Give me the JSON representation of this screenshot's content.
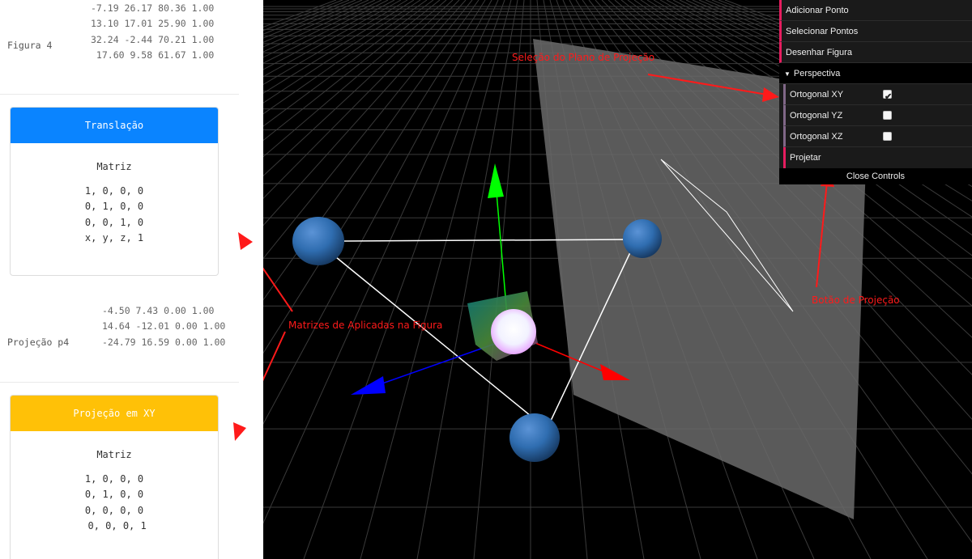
{
  "figure4": {
    "label": "Figura 4",
    "rows": [
      "-7.19 26.17 80.36 1.00",
      "13.10 17.01 25.90 1.00",
      "32.24 -2.44 70.21 1.00",
      " 17.60 9.58 61.67 1.00"
    ]
  },
  "translation_card": {
    "header": "Translação",
    "header_color": "#0a84ff",
    "title": "Matriz",
    "rows": [
      "1, 0, 0, 0",
      "0, 1, 0, 0",
      "0, 0, 1, 0",
      "x, y, z, 1"
    ]
  },
  "projection_p4": {
    "label": "Projeção p4",
    "rows": [
      "-4.50 7.43 0.00 1.00",
      "14.64 -12.01 0.00 1.00",
      "-24.79 16.59 0.00 1.00"
    ]
  },
  "projection_card": {
    "header": "Projeção em XY",
    "header_color": "#ffc107",
    "title": "Matriz",
    "rows": [
      "1, 0, 0, 0",
      "0, 1, 0, 0",
      "0, 0, 0, 0",
      " 0, 0, 0, 1"
    ]
  },
  "controls": {
    "add_point": "Adicionar Ponto",
    "select_points": "Selecionar Pontos",
    "draw_figure": "Desenhar Figura",
    "perspective_folder": "Perspectiva",
    "ortho_xy": {
      "label": "Ortogonal XY",
      "checked": true
    },
    "ortho_yz": {
      "label": "Ortogonal YZ",
      "checked": false
    },
    "ortho_xz": {
      "label": "Ortogonal XZ",
      "checked": false
    },
    "project": "Projetar",
    "close": "Close Controls"
  },
  "annotations": {
    "plane_selection": "Seleção do Plano de Projeção",
    "applied_matrices": "Matrizes de Aplicadas na Figura",
    "projection_button": "Botão de Projeção"
  },
  "colors": {
    "annotation": "#ff1a1a",
    "axis_x": "#ff0000",
    "axis_y": "#00ff00",
    "axis_z": "#0000ff",
    "sphere": "#2f6db0",
    "plane": "#6a6a6a"
  }
}
